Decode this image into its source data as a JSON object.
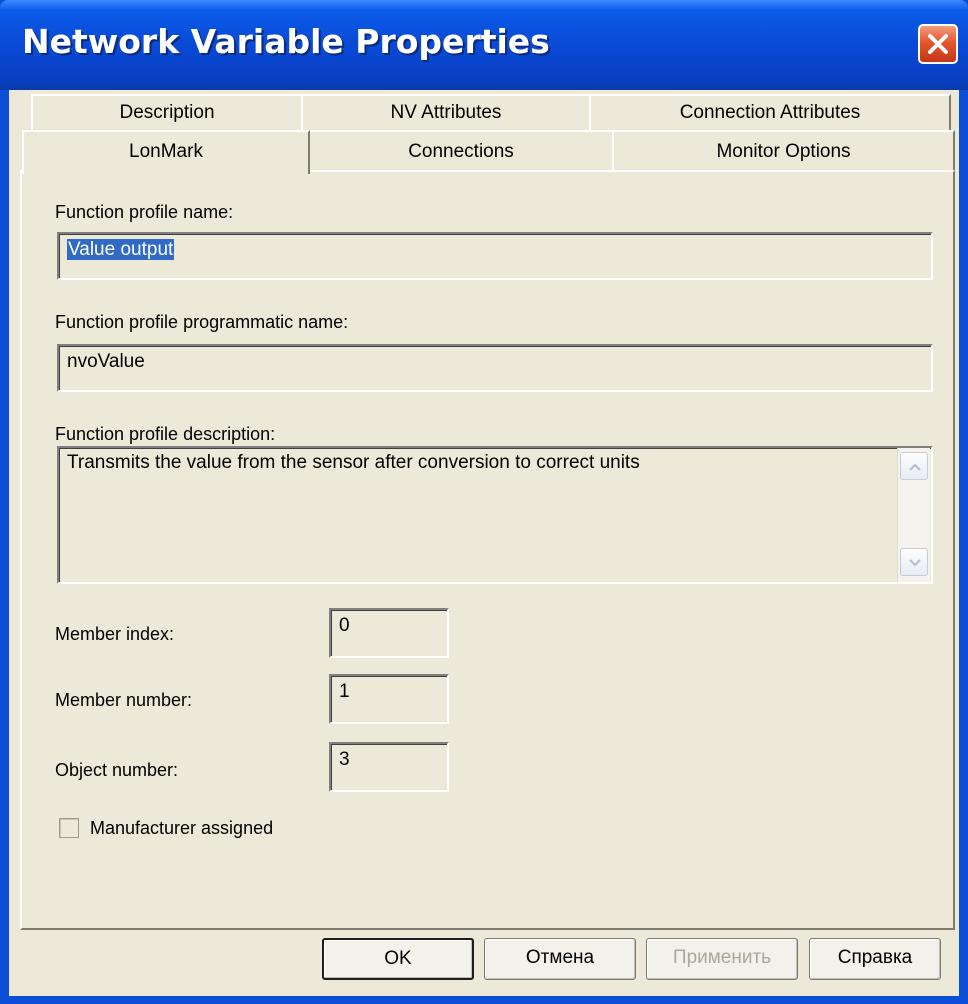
{
  "window": {
    "title": "Network Variable Properties"
  },
  "tabs": {
    "row1": [
      "Description",
      "NV Attributes",
      "Connection Attributes"
    ],
    "row2": [
      "LonMark",
      "Connections",
      "Monitor Options"
    ],
    "active": "LonMark"
  },
  "form": {
    "fp_name_label": "Function profile name:",
    "fp_name_value": "Value output",
    "fp_prog_label": "Function profile programmatic name:",
    "fp_prog_value": "nvoValue",
    "fp_desc_label": "Function profile description:",
    "fp_desc_value": "Transmits the value from the sensor after conversion to correct units",
    "member_index_label": "Member index:",
    "member_index_value": "0",
    "member_number_label": "Member number:",
    "member_number_value": "1",
    "object_number_label": "Object number:",
    "object_number_value": "3",
    "manufacturer_label": "Manufacturer assigned",
    "manufacturer_checked": false
  },
  "buttons": {
    "ok": "OK",
    "cancel": "Отмена",
    "apply": "Применить",
    "help": "Справка"
  },
  "colors": {
    "titlebar": "#0a4ad6",
    "dialog_bg": "#ece9d8",
    "selection": "#316ac5",
    "close_button": "#e4572c"
  }
}
